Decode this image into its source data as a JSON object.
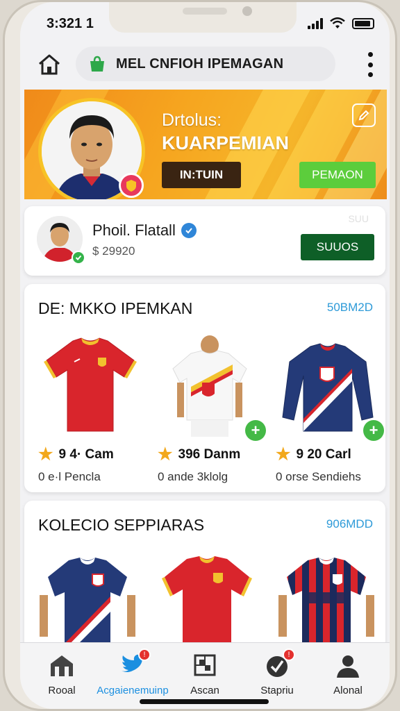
{
  "status_bar": {
    "time": "3:321 1"
  },
  "top_bar": {
    "url_text": "MEL CNFIOH IPEMAGAN"
  },
  "hero": {
    "label": "Drtolus:",
    "name": "KUARPEMIAN",
    "button_dark": "IN:TUIN",
    "button_green": "PEMAON",
    "colors": {
      "accent": "#f6a51f",
      "dark_button": "#3a2412",
      "green_button": "#5ccd3c"
    }
  },
  "profile": {
    "name": "Phoil. Flatall",
    "balance": "$ 29920",
    "action": "SUUOS",
    "faint_tag": "SUU"
  },
  "sections": [
    {
      "title": "DE: MKKO IPEMKAN",
      "link": "50BM2D",
      "products": [
        {
          "rating": "9 4· Cam",
          "subtitle": "0 e·l Pencla",
          "icon": "jersey-red"
        },
        {
          "rating": "396  Danm",
          "subtitle": "0 ande 3klolg",
          "icon": "jersey-white"
        },
        {
          "rating": "9 20 Carl",
          "subtitle": "0 orse Sendiehs",
          "icon": "jersey-navy"
        }
      ]
    },
    {
      "title": "KOLECIO SEPPIARAS",
      "link": "906MDD",
      "products": [
        {
          "icon": "jersey-navy"
        },
        {
          "icon": "jersey-red"
        },
        {
          "icon": "jersey-striped"
        }
      ]
    }
  ],
  "tabs": [
    {
      "label": "Rooal",
      "icon": "home-icon",
      "active": false
    },
    {
      "label": "Acgaienemuinp",
      "icon": "bird-icon",
      "active": true,
      "badge": "!"
    },
    {
      "label": "Ascan",
      "icon": "scan-icon",
      "active": false
    },
    {
      "label": "Stapriu",
      "icon": "check-icon",
      "active": false,
      "badge": "!"
    },
    {
      "label": "Alonal",
      "icon": "profile-icon",
      "active": false
    }
  ]
}
